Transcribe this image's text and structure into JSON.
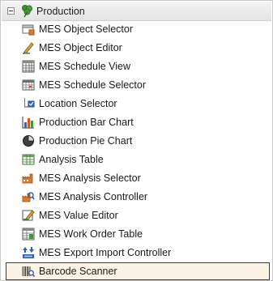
{
  "group": {
    "label": "Production",
    "icon": "clover-icon",
    "expanded": true
  },
  "items": [
    {
      "label": "MES Object Selector",
      "icon": "object-selector-icon"
    },
    {
      "label": "MES Object Editor",
      "icon": "pencil-icon"
    },
    {
      "label": "MES Schedule View",
      "icon": "schedule-grid-icon"
    },
    {
      "label": "MES Schedule Selector",
      "icon": "calendar-selector-icon"
    },
    {
      "label": "Location Selector",
      "icon": "location-selector-icon"
    },
    {
      "label": "Production Bar Chart",
      "icon": "bar-chart-icon"
    },
    {
      "label": "Production Pie Chart",
      "icon": "pie-chart-icon"
    },
    {
      "label": "Analysis Table",
      "icon": "table-icon"
    },
    {
      "label": "MES Analysis Selector",
      "icon": "analysis-selector-icon"
    },
    {
      "label": "MES Analysis Controller",
      "icon": "analysis-controller-icon"
    },
    {
      "label": "MES Value Editor",
      "icon": "value-editor-icon"
    },
    {
      "label": "MES Work Order Table",
      "icon": "work-order-table-icon"
    },
    {
      "label": "MES Export Import Controller",
      "icon": "export-import-icon"
    },
    {
      "label": "Barcode Scanner",
      "icon": "barcode-scanner-icon",
      "selected": true
    }
  ],
  "colors": {
    "selected_background": "#fdf3e4",
    "selected_border": "#3b3b3b",
    "header_background": "#e9e9e9"
  }
}
